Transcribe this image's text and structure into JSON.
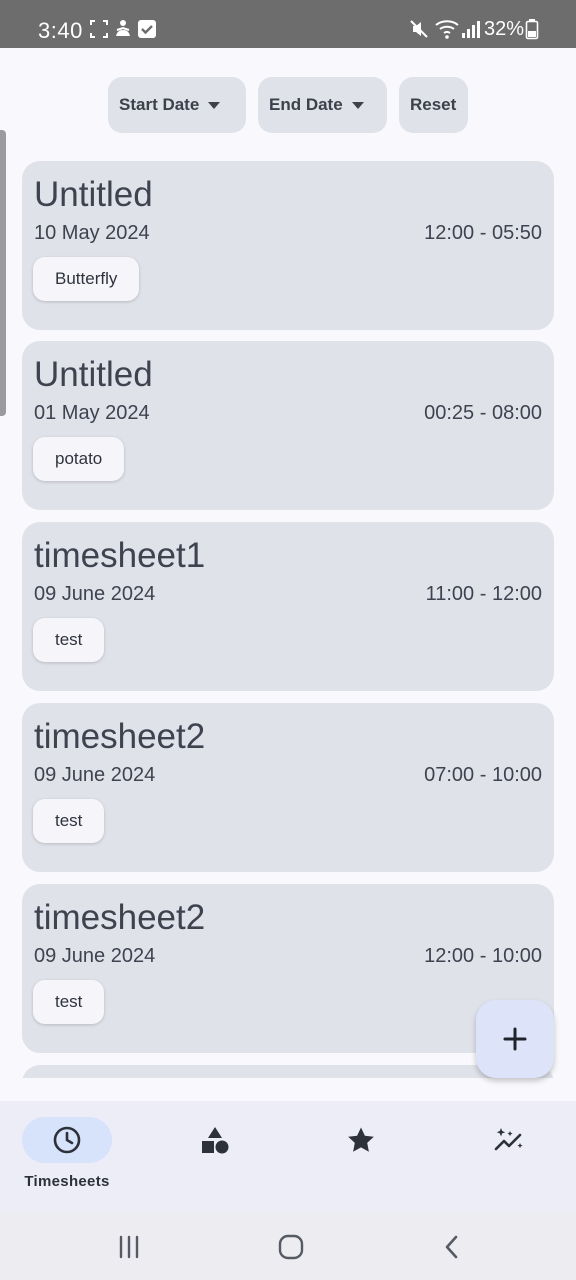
{
  "status_bar": {
    "time": "3:40",
    "battery": "32%",
    "left_icons": [
      "screenshot-frame-icon",
      "accessibility-icon",
      "checkbox-icon"
    ],
    "right_icons": [
      "mute-icon",
      "wifi-icon",
      "signal-icon",
      "battery-icon"
    ]
  },
  "filters": {
    "start_date_label": "Start Date",
    "end_date_label": "End Date",
    "reset_label": "Reset"
  },
  "timesheets": [
    {
      "title": "Untitled",
      "date": "10 May 2024",
      "time_range": "12:00 - 05:50",
      "tag": "Butterfly"
    },
    {
      "title": "Untitled",
      "date": "01 May 2024",
      "time_range": "00:25 - 08:00",
      "tag": "potato"
    },
    {
      "title": "timesheet1",
      "date": "09 June 2024",
      "time_range": "11:00 - 12:00",
      "tag": "test"
    },
    {
      "title": "timesheet2",
      "date": "09 June 2024",
      "time_range": "07:00 - 10:00",
      "tag": "test"
    },
    {
      "title": "timesheet2",
      "date": "09 June 2024",
      "time_range": "12:00 - 10:00",
      "tag": "test"
    }
  ],
  "fab": {
    "icon": "plus-icon"
  },
  "bottom_nav": {
    "items": [
      {
        "label": "Timesheets",
        "icon": "clock-icon",
        "active": true
      },
      {
        "label": "",
        "icon": "shapes-icon",
        "active": false
      },
      {
        "label": "",
        "icon": "star-icon",
        "active": false
      },
      {
        "label": "",
        "icon": "sparkle-chart-icon",
        "active": false
      }
    ]
  },
  "system_nav": {
    "buttons": [
      "recent-apps-icon",
      "home-icon",
      "back-icon"
    ]
  },
  "colors": {
    "card_bg": "#e0e2ea",
    "page_bg": "#f9f9fd",
    "status_bar_bg": "#6d6d6d",
    "nav_bg": "#ecedf7",
    "active_pill": "#d7e2fb",
    "fab_bg": "#dde3f8",
    "text": "#3f4350"
  }
}
